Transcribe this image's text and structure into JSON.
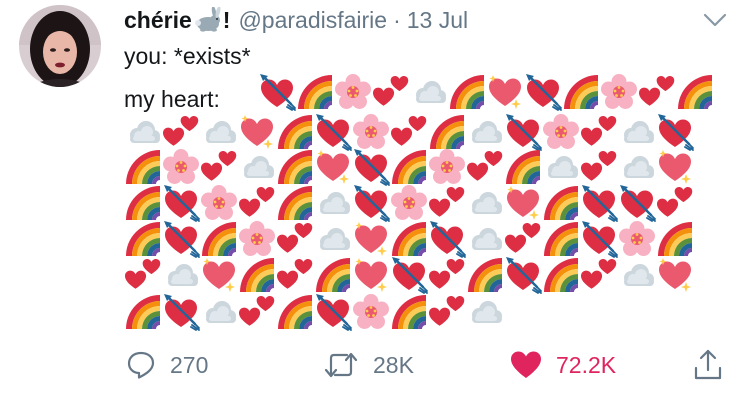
{
  "tweet": {
    "display_name": "chérie",
    "name_suffix": "!",
    "handle": "@paradisfairie",
    "separator": "·",
    "date": "13 Jul",
    "line1": "you: *exists*",
    "line2_prefix": "my heart:",
    "emoji_rows": [
      [
        "heart-arrow",
        "rainbow",
        "cherry-blossom",
        "two-hearts",
        "cloud",
        "rainbow",
        "sparkling-heart",
        "heart-arrow",
        "rainbow",
        "cherry-blossom",
        "two-hearts",
        "rainbow"
      ],
      [
        "cloud",
        "two-hearts",
        "cloud",
        "sparkling-heart",
        "rainbow",
        "heart-arrow",
        "cherry-blossom",
        "two-hearts",
        "rainbow",
        "cloud",
        "heart-arrow",
        "cherry-blossom",
        "two-hearts",
        "cloud",
        "heart-arrow"
      ],
      [
        "rainbow",
        "cherry-blossom",
        "two-hearts",
        "cloud",
        "rainbow",
        "sparkling-heart",
        "heart-arrow",
        "rainbow",
        "cherry-blossom",
        "two-hearts",
        "rainbow",
        "cloud",
        "two-hearts",
        "cloud",
        "sparkling-heart"
      ],
      [
        "rainbow",
        "heart-arrow",
        "cherry-blossom",
        "two-hearts",
        "rainbow",
        "cloud",
        "heart-arrow",
        "cherry-blossom",
        "two-hearts",
        "cloud",
        "sparkling-heart",
        "rainbow",
        "heart-arrow",
        "heart-arrow",
        "two-hearts"
      ],
      [
        "rainbow",
        "heart-arrow",
        "rainbow",
        "cherry-blossom",
        "two-hearts",
        "cloud",
        "sparkling-heart",
        "rainbow",
        "heart-arrow",
        "cloud",
        "two-hearts",
        "rainbow",
        "heart-arrow",
        "cherry-blossom",
        "rainbow"
      ],
      [
        "two-hearts",
        "cloud",
        "sparkling-heart",
        "rainbow",
        "two-hearts",
        "rainbow",
        "sparkling-heart",
        "heart-arrow",
        "two-hearts",
        "rainbow",
        "heart-arrow",
        "rainbow",
        "two-hearts",
        "cloud",
        "sparkling-heart"
      ],
      [
        "rainbow",
        "heart-arrow",
        "cloud",
        "two-hearts",
        "rainbow",
        "heart-arrow",
        "cherry-blossom",
        "rainbow",
        "two-hearts",
        "cloud"
      ]
    ]
  },
  "actions": {
    "reply_icon": "speech-bubble-icon",
    "reply_count": "270",
    "retweet_icon": "retweet-icon",
    "retweet_count": "28K",
    "like_icon": "heart-icon",
    "like_count": "72.2K",
    "share_icon": "share-icon"
  },
  "colors": {
    "text": "#14171a",
    "secondary": "#657786",
    "like": "#e0245e",
    "heart_emoji": "#dd2e44",
    "heart_emoji_light": "#ea596e"
  }
}
